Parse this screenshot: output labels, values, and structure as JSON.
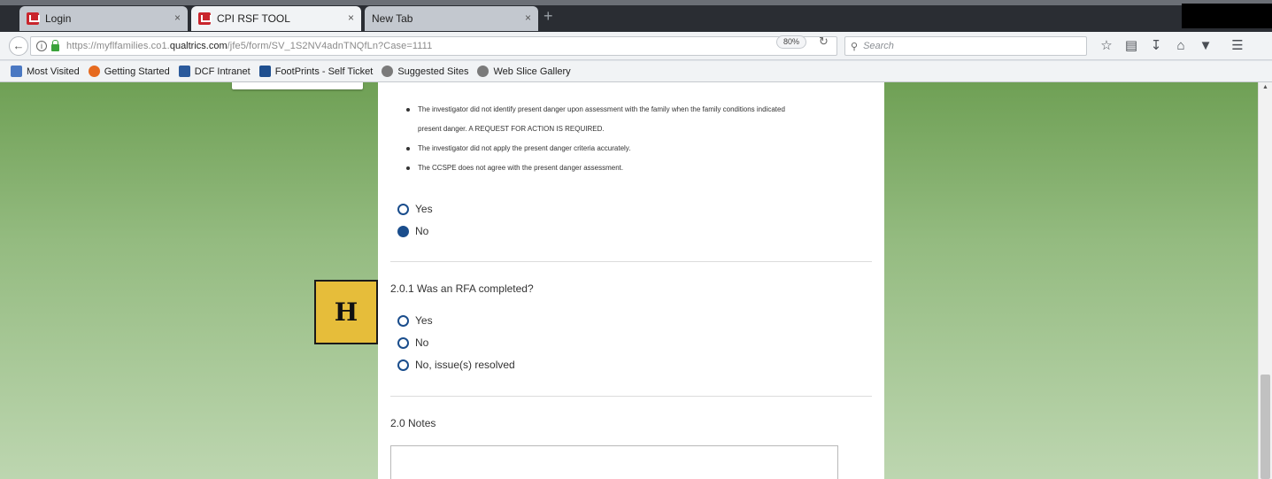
{
  "browser": {
    "tabs": [
      {
        "label": "Login",
        "close": "×"
      },
      {
        "label": "CPI RSF TOOL",
        "close": "×"
      },
      {
        "label": "New Tab",
        "close": "×"
      }
    ],
    "new_tab": "+",
    "url_prefix": "https://myflfamilies.co1.",
    "url_host": "qualtrics.com",
    "url_path": "/jfe5/form/SV_1S2NV4adnTNQfLn?Case=1111",
    "zoom": "80%",
    "search_placeholder": "Search",
    "bookmarks": [
      {
        "label": "Most Visited",
        "color": "#4a78c2"
      },
      {
        "label": "Getting Started",
        "color": "#e66a1f"
      },
      {
        "label": "DCF Intranet",
        "color": "#2b5a9c"
      },
      {
        "label": "FootPrints - Self Ticket",
        "color": "#1f4f8f"
      },
      {
        "label": "Suggested Sites",
        "color": "#7a7a7a"
      },
      {
        "label": "Web Slice Gallery",
        "color": "#7a7a7a"
      }
    ]
  },
  "survey": {
    "bullets": [
      "The investigator did not identify present danger upon assessment with the family when the family conditions indicated",
      "The investigator did not apply the present danger criteria accurately.",
      "The CCSPE does not agree with the present danger assessment."
    ],
    "bullet_continuation": "present danger.  A REQUEST FOR ACTION IS REQUIRED.",
    "q1_options": [
      {
        "label": "Yes",
        "checked": false
      },
      {
        "label": "No",
        "checked": true
      }
    ],
    "q2_title": "2.0.1 Was an RFA completed?",
    "q2_options": [
      {
        "label": "Yes",
        "checked": false
      },
      {
        "label": "No",
        "checked": false
      },
      {
        "label": "No, issue(s) resolved",
        "checked": false
      }
    ],
    "notes_title": "2.0 Notes",
    "marker_letter": "H"
  }
}
